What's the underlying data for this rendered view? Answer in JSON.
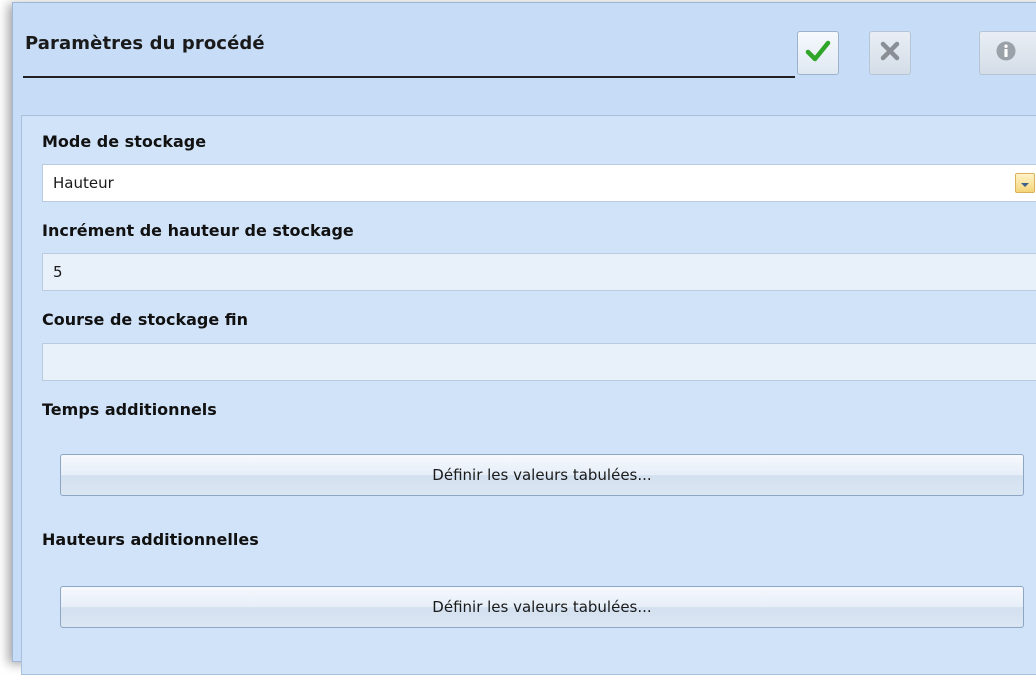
{
  "dialog": {
    "title": "Paramètres du procédé",
    "buttons": {
      "ok_icon": "checkmark-icon",
      "cancel_icon": "cross-icon",
      "info_icon": "info-icon"
    }
  },
  "form": {
    "storage_mode": {
      "label": "Mode de stockage",
      "value": "Hauteur",
      "dropdown_icon": "chevron-down-icon"
    },
    "storage_height_increment": {
      "label": "Incrément de hauteur de stockage",
      "value": "5"
    },
    "fine_storage_stroke": {
      "label": "Course de stockage fin",
      "value": ""
    },
    "additional_times": {
      "label": "Temps additionnels",
      "button_label": "Définir les valeurs tabulées..."
    },
    "additional_heights": {
      "label": "Hauteurs additionnelles",
      "button_label": "Définir les valeurs tabulées..."
    }
  },
  "colors": {
    "background": "#c7dcf6",
    "panel": "#d1e3f9",
    "ok_green": "#2fa52a",
    "cancel_gray": "#8a8f95"
  }
}
